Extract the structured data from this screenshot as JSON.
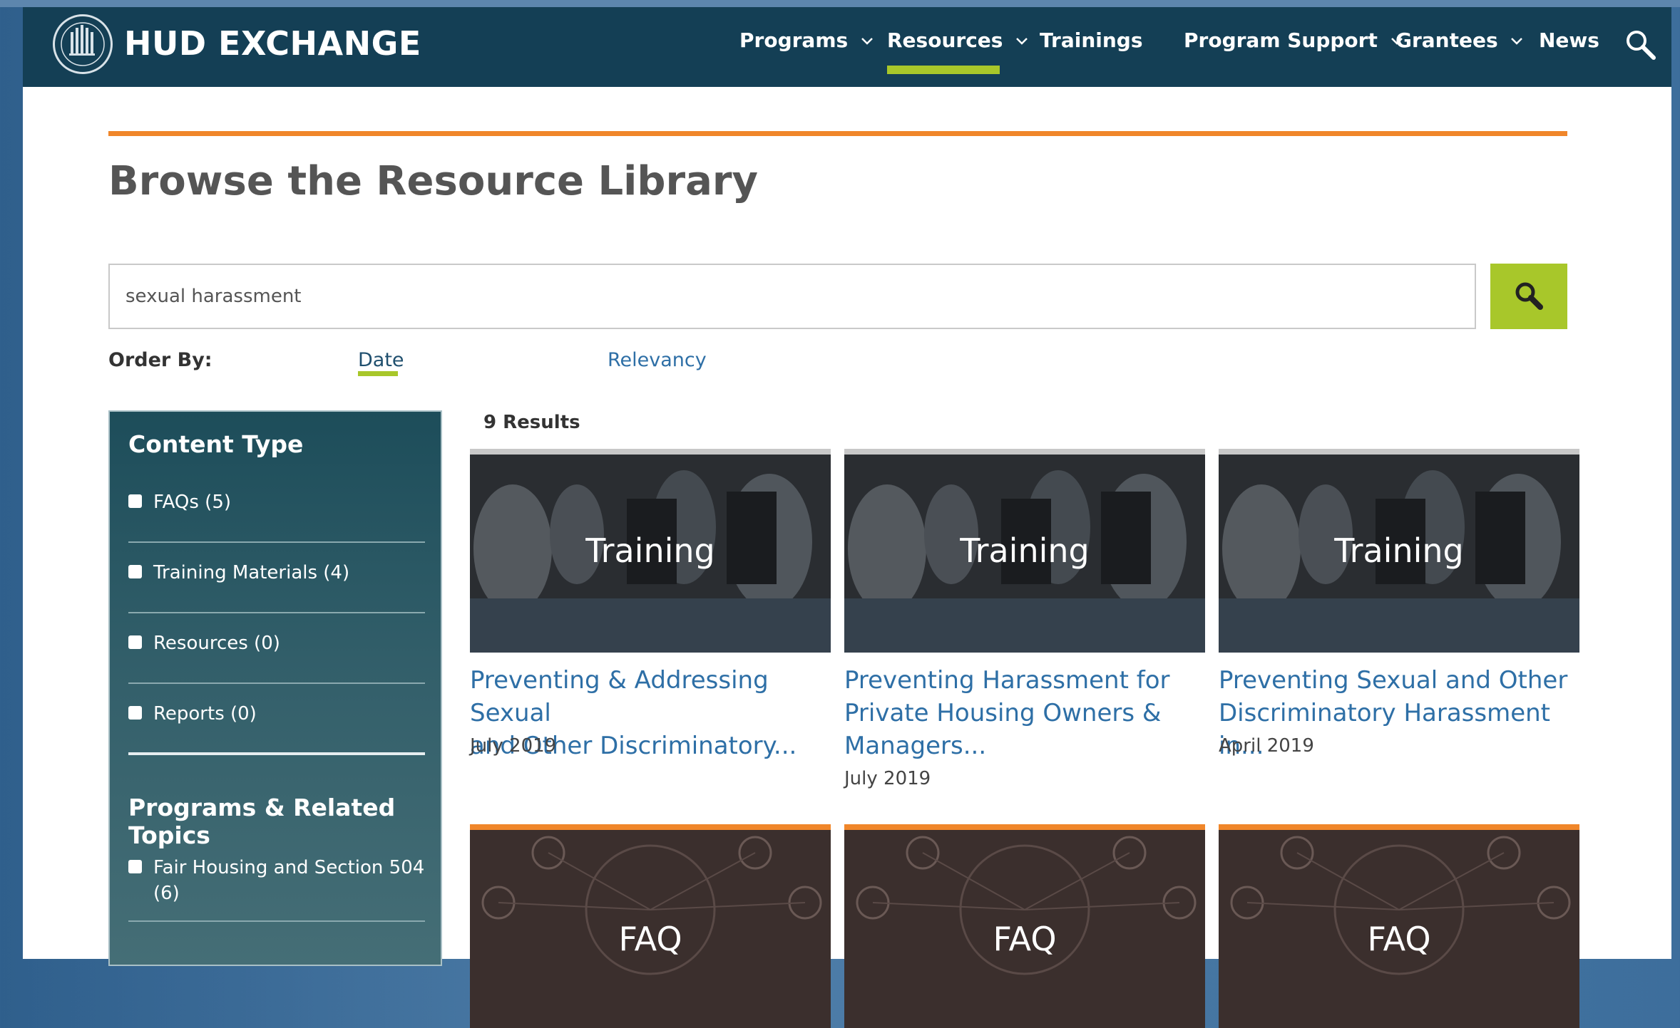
{
  "header": {
    "logo_text": "HUD EXCHANGE",
    "nav": [
      {
        "label": "Programs",
        "has_dropdown": true,
        "active": false
      },
      {
        "label": "Resources",
        "has_dropdown": true,
        "active": true
      },
      {
        "label": "Trainings",
        "has_dropdown": false,
        "active": false
      },
      {
        "label": "Program Support",
        "has_dropdown": true,
        "active": false
      },
      {
        "label": "Grantees",
        "has_dropdown": true,
        "active": false
      },
      {
        "label": "News",
        "has_dropdown": false,
        "active": false
      }
    ],
    "search_icon": "search-icon"
  },
  "page": {
    "title": "Browse the Resource Library",
    "search_value": "sexual harassment",
    "order_by": {
      "label": "Order By:",
      "options": [
        "Date",
        "Relevancy"
      ],
      "selected": "Date"
    }
  },
  "sidebar": {
    "content_type_heading": "Content Type",
    "content_types": [
      {
        "label": "FAQs (5)",
        "checked": false
      },
      {
        "label": "Training Materials (4)",
        "checked": false
      },
      {
        "label": "Resources (0)",
        "checked": false
      },
      {
        "label": "Reports (0)",
        "checked": false
      }
    ],
    "topics_heading": "Programs & Related Topics",
    "topics": [
      {
        "label_line1": "Fair Housing and Section 504",
        "label_line2": "(6)",
        "checked": false
      }
    ]
  },
  "results": {
    "count_label": "9 Results",
    "cards": [
      {
        "image_label": "Training",
        "title_line1": "Preventing & Addressing Sexual",
        "title_line2": "and Other Discriminatory...",
        "title_line3": "",
        "date": "July 2019"
      },
      {
        "image_label": "Training",
        "title_line1": "Preventing Harassment for",
        "title_line2": "Private Housing Owners &",
        "title_line3": "Managers...",
        "date": "July 2019"
      },
      {
        "image_label": "Training",
        "title_line1": "Preventing Sexual and Other",
        "title_line2": "Discriminatory Harassment in...",
        "title_line3": "",
        "date": "April 2019"
      },
      {
        "image_label": "FAQ"
      },
      {
        "image_label": "FAQ"
      },
      {
        "image_label": "FAQ"
      }
    ]
  },
  "colors": {
    "header_bg": "#143f55",
    "accent_green": "#a8c72a",
    "accent_orange": "#f0862a",
    "link_blue": "#2e6fa6"
  }
}
